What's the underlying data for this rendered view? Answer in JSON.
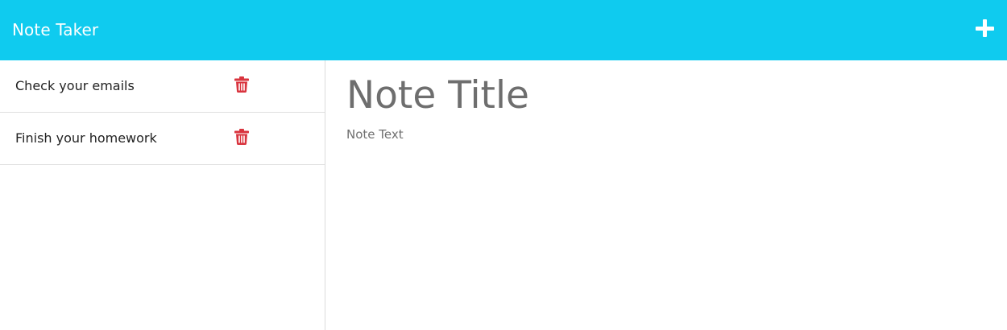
{
  "navbar": {
    "brand": "Note Taker",
    "new_note_icon": "plus-icon"
  },
  "notes": [
    {
      "title": "Check your emails",
      "icon": "trash-icon"
    },
    {
      "title": "Finish your homework",
      "icon": "trash-icon"
    }
  ],
  "editor": {
    "title_placeholder": "Note Title",
    "text_placeholder": "Note Text"
  },
  "colors": {
    "navbar_bg": "#0fcbef",
    "delete_icon": "#d9343e",
    "text": "#222222",
    "placeholder": "#6e6e6e"
  }
}
